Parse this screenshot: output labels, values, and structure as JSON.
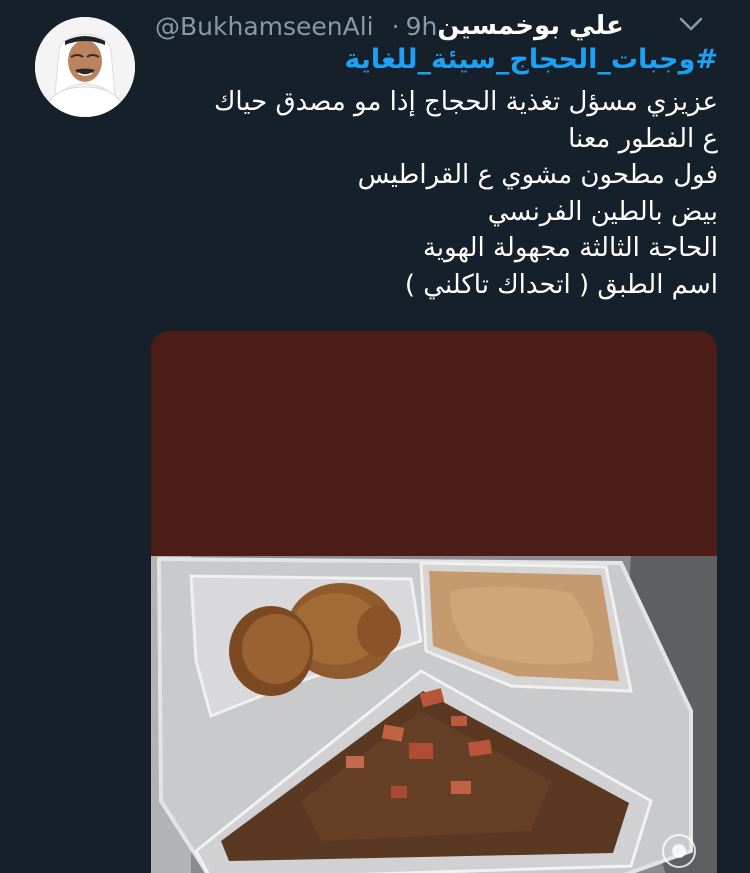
{
  "tweet": {
    "author_name": "علي بوخمسين",
    "handle": "@BukhamseenAli",
    "separator": "·",
    "time": "9h",
    "hashtag": "#وجبات_الحجاج_سيئة_للغاية",
    "lines": [
      "عزيزي مسؤل تغذية الحجاج إذا مو مصدق حياك",
      "ع الفطور معنا",
      "فول مطحون مشوي ع القراطيس",
      "بيض بالطين الفرنسي",
      "الحاجة الثالثة مجهولة الهوية",
      "اسم الطبق ( اتحداك تاكلني )"
    ]
  },
  "icons": {
    "more": "chevron-down-icon",
    "avatar": "profile-photo",
    "watermark": "snapchat-watermark-icon"
  },
  "colors": {
    "background": "#15202b",
    "text": "#ffffff",
    "secondary": "#8899a6",
    "link": "#1da1f2",
    "media_top": "#4c1d16"
  }
}
